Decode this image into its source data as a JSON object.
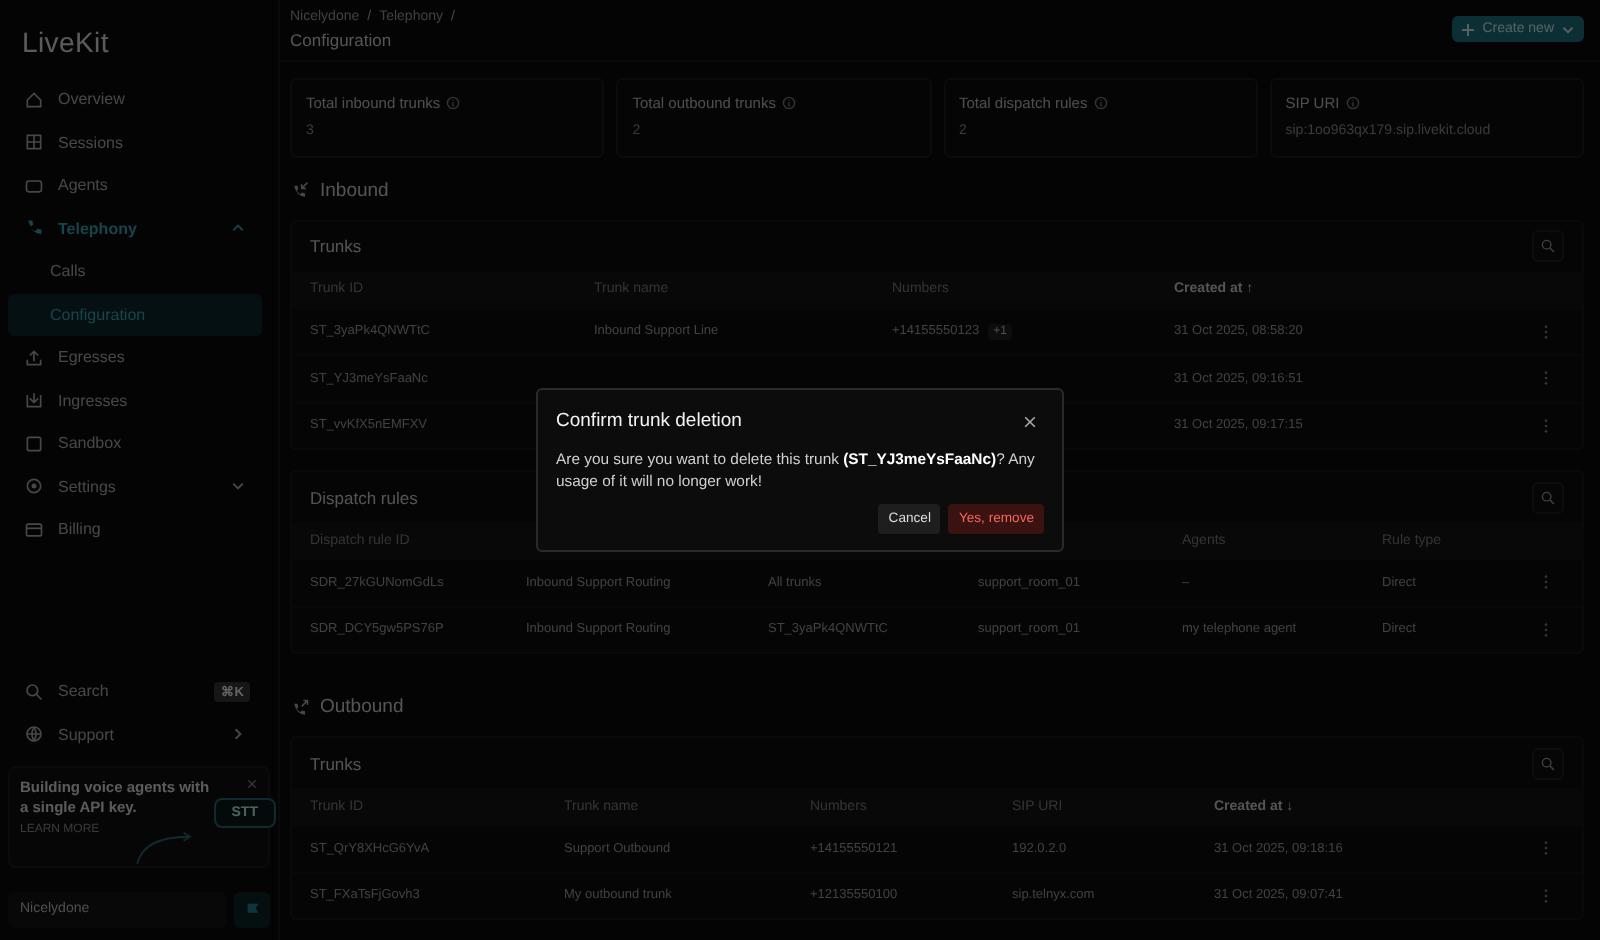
{
  "sidebar": {
    "logo": "LiveKit",
    "nav": [
      {
        "label": "Overview",
        "selected": false
      },
      {
        "label": "Sessions",
        "selected": false
      },
      {
        "label": "Agents",
        "selected": false
      },
      {
        "label": "Telephony",
        "selected": true,
        "expanded": true,
        "children": [
          {
            "label": "Calls",
            "selected": false
          },
          {
            "label": "Configuration",
            "selected": true
          }
        ]
      },
      {
        "label": "Egresses",
        "selected": false
      },
      {
        "label": "Ingresses",
        "selected": false
      },
      {
        "label": "Sandbox",
        "selected": false
      },
      {
        "label": "Settings",
        "selected": false,
        "expanded": false
      },
      {
        "label": "Billing",
        "selected": false
      }
    ],
    "search": {
      "label": "Search",
      "shortcut": "⌘K"
    },
    "support": "Support",
    "promo": {
      "text": "Building voice agents with a single API key.",
      "link": "LEARN MORE",
      "pill": "STT"
    },
    "project": "Nicelydone"
  },
  "breadcrumb": [
    "Nicelydone",
    "Telephony"
  ],
  "breadcrumb_separator": "/",
  "page_title": "Configuration",
  "create_button": "Create new",
  "stats": [
    {
      "label": "Total inbound trunks",
      "value": "3"
    },
    {
      "label": "Total outbound trunks",
      "value": "2"
    },
    {
      "label": "Total dispatch rules",
      "value": "2"
    },
    {
      "label": "SIP URI",
      "value": "sip:1oo963qx179.sip.livekit.cloud"
    }
  ],
  "sections": [
    {
      "title": "Inbound",
      "tables": [
        {
          "title": "Trunks",
          "columns": [
            "Trunk ID",
            "Trunk name",
            "Numbers",
            "Created at ↑"
          ],
          "rows": [
            [
              "ST_3yaPk4QNWTtC",
              "Inbound Support Line",
              "+14155550123",
              "31 Oct 2025, 08:58:20"
            ],
            [
              "ST_YJ3meYsFaaNc",
              null,
              null,
              "31 Oct 2025, 09:16:51"
            ],
            [
              "ST_vvKfX5nEMFXV",
              null,
              null,
              "31 Oct 2025, 09:17:15"
            ]
          ],
          "extra_badge": "+1"
        },
        {
          "title": "Dispatch rules",
          "columns": [
            "Dispatch rule ID",
            null,
            null,
            null,
            "Agents",
            "Rule type"
          ],
          "rows": [
            [
              "SDR_27kGUNomGdLs",
              "Inbound Support Routing",
              "All trunks",
              "support_room_01",
              "–",
              "Direct"
            ],
            [
              "SDR_DCY5gw5PS76P",
              "Inbound Support Routing",
              "ST_3yaPk4QNWTtC",
              "support_room_01",
              "my telephone agent",
              "Direct"
            ]
          ]
        }
      ]
    },
    {
      "title": "Outbound",
      "tables": [
        {
          "title": "Trunks",
          "columns": [
            "Trunk ID",
            "Trunk name",
            "Numbers",
            "SIP URI",
            "Created at ↓"
          ],
          "rows": [
            [
              "ST_QrY8XHcG6YvA",
              "Support Outbound",
              "+14155550121",
              "192.0.2.0",
              "31 Oct 2025, 09:18:16"
            ],
            [
              "ST_FXaTsFjGovh3",
              "My outbound trunk",
              "+12135550100",
              "sip.telnyx.com",
              "31 Oct 2025, 09:07:41"
            ]
          ]
        }
      ]
    }
  ],
  "dialog": {
    "title": "Confirm trunk deletion",
    "message": "Are you sure you want to delete this trunk **(ST_YJ3meYsFaaNc)**? Any usage of it will no longer work!",
    "buttons": [
      {
        "label": "Cancel",
        "kind": "secondary"
      },
      {
        "label": "Yes, remove",
        "kind": "danger"
      }
    ]
  }
}
